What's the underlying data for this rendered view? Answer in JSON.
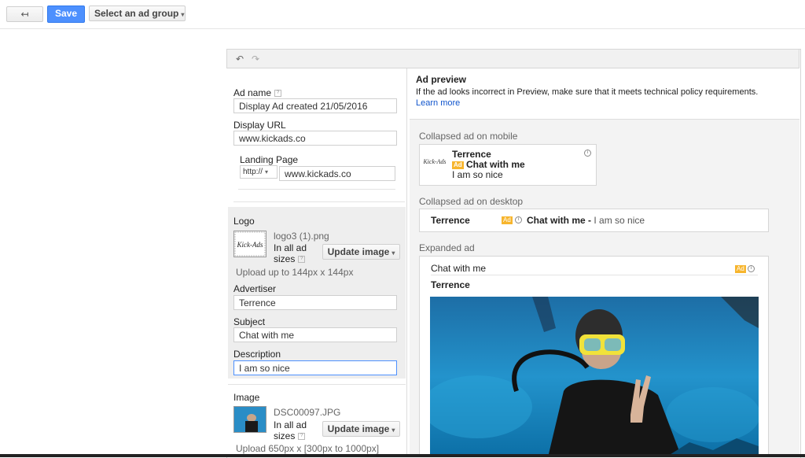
{
  "toolbar": {
    "back_icon": "back-arrow-icon",
    "back_glyph": "↤",
    "save_label": "Save",
    "ad_group_label": "Select an ad group"
  },
  "editor": {
    "undo_glyph": "↶",
    "redo_glyph": "↷",
    "ad_name_label": "Ad name",
    "ad_name_value": "Display Ad created 21/05/2016",
    "display_url_label": "Display URL",
    "display_url_value": "www.kickads.co",
    "landing_page_label": "Landing Page",
    "protocol_value": "http://",
    "landing_url_value": "www.kickads.co",
    "logo_label": "Logo",
    "logo_filename": "logo3 (1).png",
    "logo_sizes_text_1": "In all ad",
    "logo_sizes_text_2": "sizes",
    "update_image_label": "Update image",
    "logo_upload_hint": "Upload up to 144px x 144px",
    "advertiser_label": "Advertiser",
    "advertiser_value": "Terrence",
    "subject_label": "Subject",
    "subject_value": "Chat with me",
    "description_label": "Description",
    "description_value": "I am so nice",
    "image_label": "Image",
    "image_filename": "DSC00097.JPG",
    "image_sizes_text_1": "In all ad",
    "image_sizes_text_2": "sizes",
    "image_upload_hint": "Upload 650px x [300px to 1000px]"
  },
  "preview": {
    "title": "Ad preview",
    "notice": "If the ad looks incorrect in Preview, make sure that it meets technical policy requirements.",
    "learn_more": "Learn more",
    "mobile_label": "Collapsed ad on mobile",
    "desktop_label": "Collapsed ad on desktop",
    "expanded_label": "Expanded ad",
    "advertiser": "Terrence",
    "subject": "Chat with me",
    "description": "I am so nice",
    "ad_badge": "Ad",
    "desktop_separator": "Chat with me -",
    "logo_text": "Kick-Ads"
  },
  "colors": {
    "primary_button": "#4d90fe",
    "ad_badge": "#f7b52d",
    "link": "#1155cc"
  }
}
